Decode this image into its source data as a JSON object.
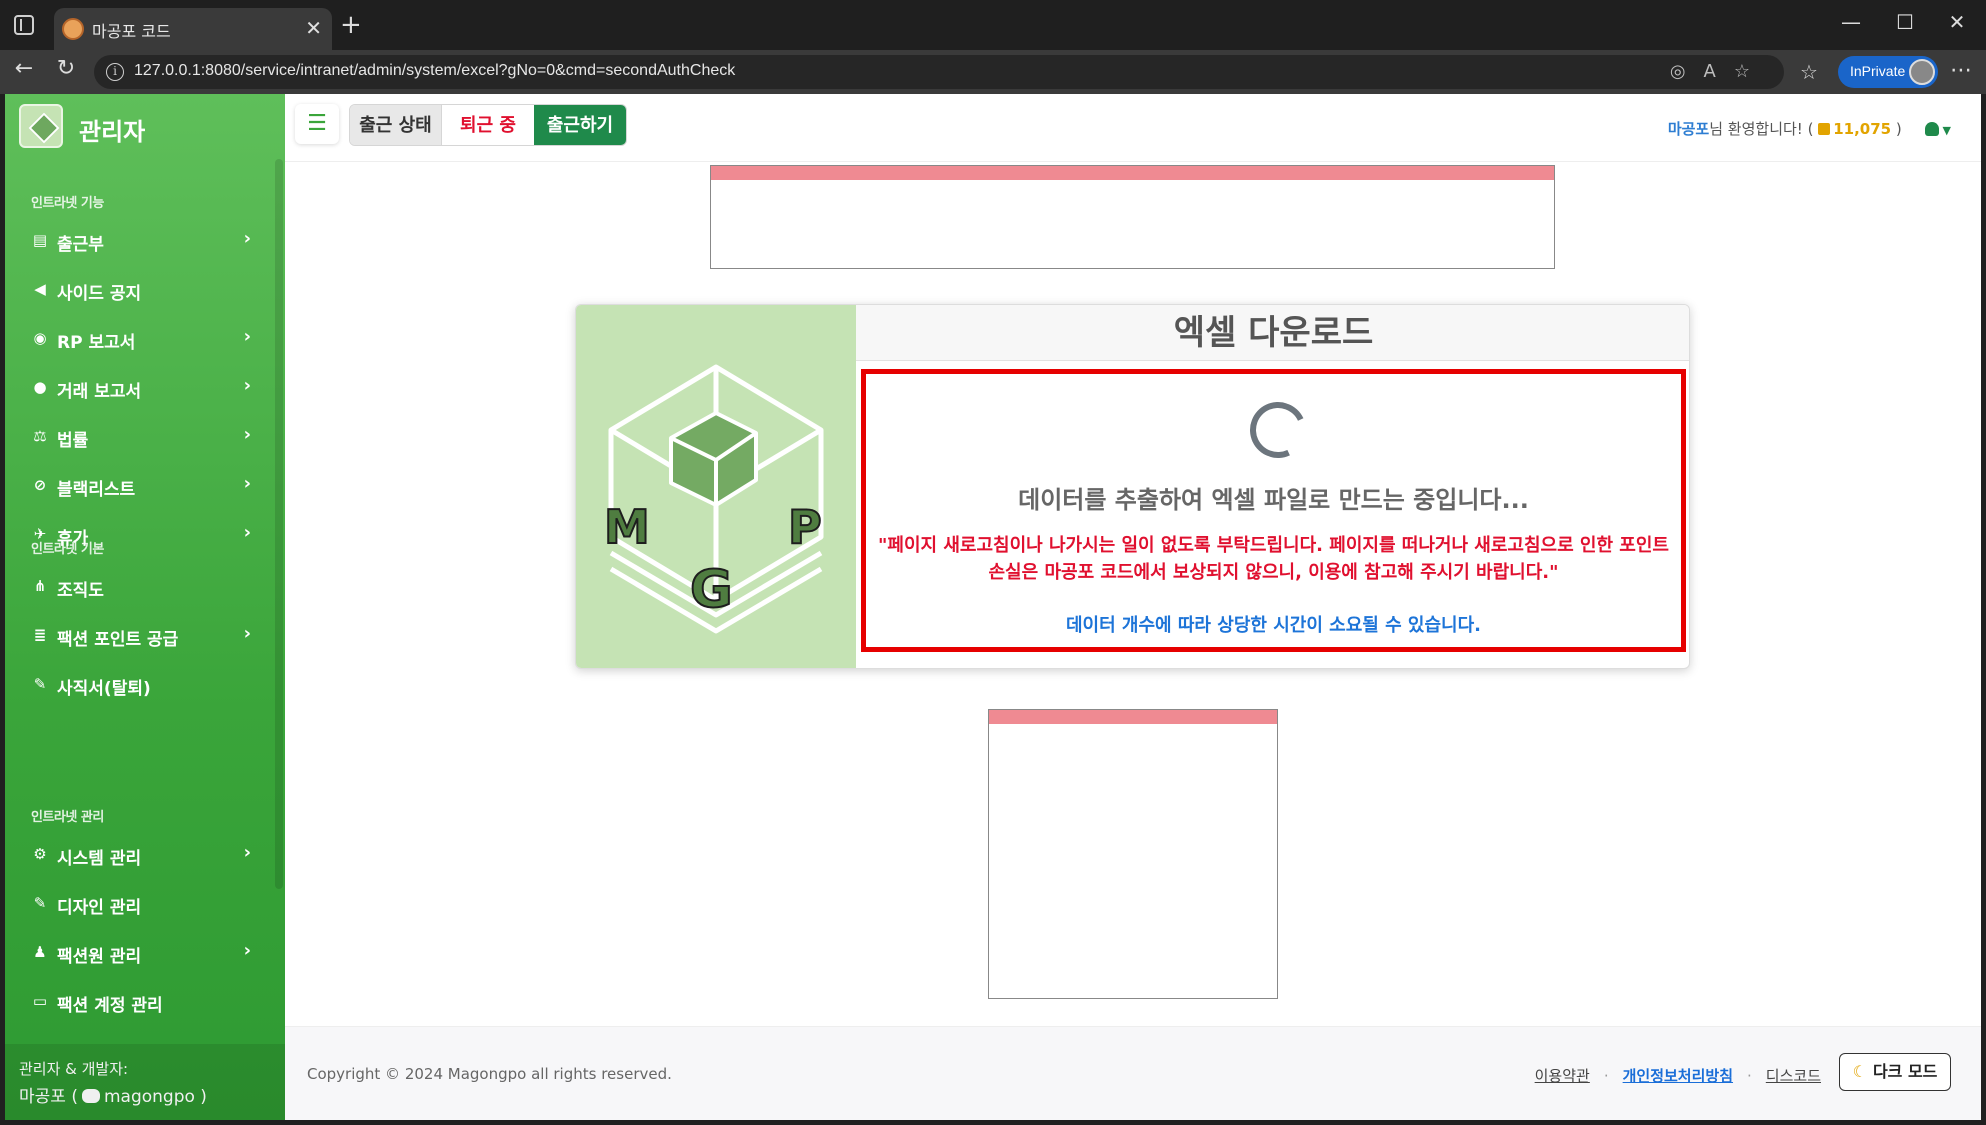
{
  "browser": {
    "tab_title": "마공포 코드",
    "tab_close": "✕",
    "new_tab": "+",
    "url": "127.0.0.1:8080/service/intranet/admin/system/excel?gNo=0&cmd=secondAuthCheck",
    "inprivate_label": "InPrivate",
    "window_min": "—",
    "window_max": "☐",
    "window_close": "✕",
    "back": "←",
    "reload": "↻",
    "favorites": "☆",
    "more": "⋯"
  },
  "sidebar": {
    "brand": "관리자",
    "sections": [
      {
        "heading": "인트라넷 기능",
        "items": [
          {
            "label": "출근부",
            "icon": "attendance-book-icon",
            "glyph": "▤",
            "chevron": true
          },
          {
            "label": "사이드 공지",
            "icon": "megaphone-icon",
            "glyph": "◀",
            "chevron": false
          },
          {
            "label": "RP 보고서",
            "icon": "gamepad-icon",
            "glyph": "◉",
            "chevron": true
          },
          {
            "label": "거래 보고서",
            "icon": "money-bag-icon",
            "glyph": "●",
            "chevron": true
          },
          {
            "label": "법률",
            "icon": "scale-icon",
            "glyph": "⚖",
            "chevron": true
          },
          {
            "label": "블랙리스트",
            "icon": "ban-icon",
            "glyph": "⊘",
            "chevron": true
          },
          {
            "label": "휴가",
            "icon": "plane-icon",
            "glyph": "✈",
            "chevron": true
          }
        ]
      },
      {
        "heading": "인트라넷 기본",
        "items": [
          {
            "label": "조직도",
            "icon": "org-chart-icon",
            "glyph": "⋔",
            "chevron": false
          },
          {
            "label": "팩션 포인트 공급",
            "icon": "coins-icon",
            "glyph": "≣",
            "chevron": true
          },
          {
            "label": "사직서(탈퇴)",
            "icon": "pen-icon",
            "glyph": "✎",
            "chevron": false
          }
        ]
      },
      {
        "heading": "인트라넷 관리",
        "items": [
          {
            "label": "시스템 관리",
            "icon": "gear-icon",
            "glyph": "⚙",
            "chevron": true
          },
          {
            "label": "디자인 관리",
            "icon": "pen-icon",
            "glyph": "✎",
            "chevron": false
          },
          {
            "label": "팩션원 관리",
            "icon": "user-gear-icon",
            "glyph": "♟",
            "chevron": true
          },
          {
            "label": "팩션 계정 관리",
            "icon": "id-card-icon",
            "glyph": "▭",
            "chevron": false
          }
        ]
      }
    ],
    "footer_line1": "관리자 & 개발자:",
    "footer_name": "마공포 (",
    "footer_discord": "magongpo )",
    "chevron_glyph": "›"
  },
  "topbar": {
    "menu_glyph": "☰",
    "status_label": "출근 상태",
    "off_label": "퇴근 중",
    "clockin_label": "출근하기",
    "welcome_name": "마공포",
    "welcome_text": "님 환영합니다! (",
    "points": "11,075",
    "welcome_close": ")",
    "user_caret": "▼"
  },
  "card": {
    "title": "엑셀 다운로드",
    "loading_text": "데이터를 추출하여 엑셀 파일로 만드는 중입니다...",
    "warning_text": "\"페이지 새로고침이나 나가시는 일이 없도록 부탁드립니다. 페이지를 떠나거나 새로고침으로 인한 포인트 손실은 마공포 코드에서 보상되지 않으니, 이용에 참고해 주시기 바랍니다.\"",
    "time_text": "데이터 개수에 따라 상당한 시간이 소요될 수 있습니다.",
    "logo_letters": [
      "M",
      "G",
      "P"
    ]
  },
  "footer": {
    "copyright": "Copyright © 2024 Magongpo all rights reserved.",
    "terms": "이용약관",
    "privacy": "개인정보처리방침",
    "discord": "디스코드",
    "separator": "·",
    "dark_mode": "다크 모드",
    "moon_glyph": "☾"
  },
  "colors": {
    "sidebar_green": "#3aa53a",
    "clockin_green": "#1f8a4b",
    "off_red": "#e0102f",
    "notice_blue": "#1d74d8",
    "alert_border": "#e60000",
    "points_gold": "#e2a400"
  }
}
